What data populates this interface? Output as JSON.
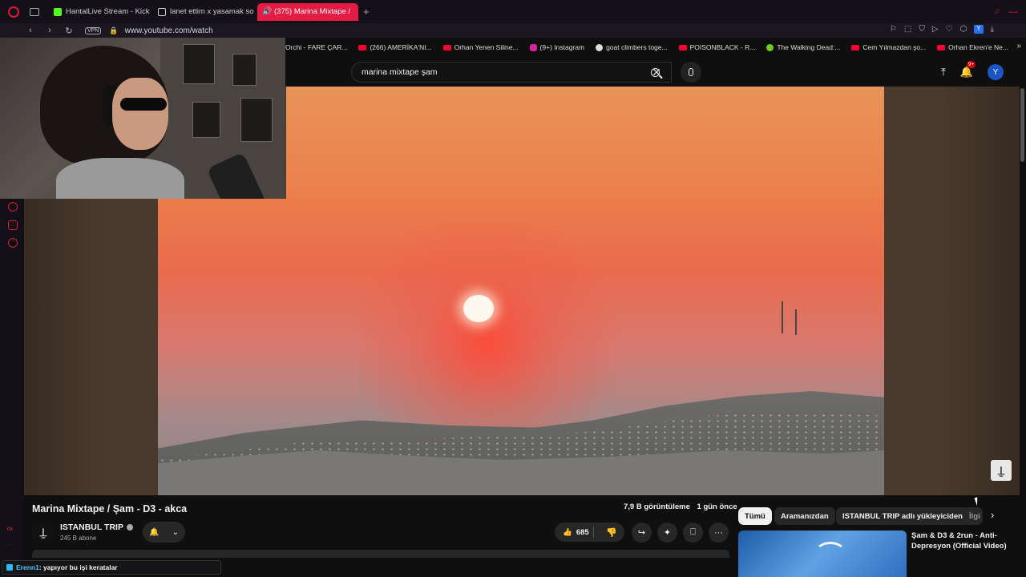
{
  "browser": {
    "tabs": [
      {
        "label": "HantalLive Stream - Kick D",
        "icon": "kick-icon",
        "active": false
      },
      {
        "label": "lanet ettim x yasamak soru",
        "icon": "doc-icon",
        "active": false
      },
      {
        "label": "(375) Marina Mixtape /",
        "icon": "speaker-icon",
        "active": true
      }
    ],
    "new_tab": "+",
    "url": "www.youtube.com/watch",
    "vpn": "VPN",
    "profile_letter": "Y",
    "bookmarks": [
      {
        "label": "Orchi - FARE ÇAR...",
        "icon": "none"
      },
      {
        "label": "(266) AMERİKA'NI...",
        "icon": "youtube-icon"
      },
      {
        "label": "Orhan Yenen Siline...",
        "icon": "youtube-icon"
      },
      {
        "label": "(9+) Instagram",
        "icon": "instagram-icon"
      },
      {
        "label": "goat climbers toge...",
        "icon": "google-icon"
      },
      {
        "label": "POISONBLACK - R...",
        "icon": "youtube-icon"
      },
      {
        "label": "The Walking Dead:...",
        "icon": "green-icon"
      },
      {
        "label": "Cem Yılmazdan şo...",
        "icon": "youtube-icon"
      },
      {
        "label": "Orhan Ekren'e Ne...",
        "icon": "youtube-icon"
      }
    ],
    "sidebar_text": "dx"
  },
  "youtube": {
    "search": {
      "value": "marina mixtape şam",
      "clear": "✕"
    },
    "notification_badge": "9+",
    "avatar_letter": "Y",
    "video": {
      "title": "Marina Mixtape / Şam - D3 - akca",
      "views": "7,9 B görüntüleme",
      "age": "1 gün önce",
      "watermark": "⍊"
    },
    "channel": {
      "name": "ISTANBUL TRIP",
      "subs": "245 B abone",
      "avatar_glyph": "⍊"
    },
    "actions": {
      "likes": "685"
    },
    "chips": [
      {
        "label": "Tümü",
        "selected": true
      },
      {
        "label": "Aramanızdan",
        "selected": false
      },
      {
        "label": "ISTANBUL TRIP adlı yükleyiciden",
        "selected": false
      },
      {
        "label": "İlgi",
        "selected": false
      }
    ],
    "recommendation": {
      "title": "Şam & D3 & 2run - Anti-Depresyon (Official Video)"
    }
  },
  "chat": {
    "user": "Erenn1",
    "message": ": yapıyor bu işi keratalar"
  },
  "colors": {
    "opera_red": "#e0173b",
    "yt_background": "#0f0f0f",
    "chip_selected": "#f1f1f1"
  }
}
